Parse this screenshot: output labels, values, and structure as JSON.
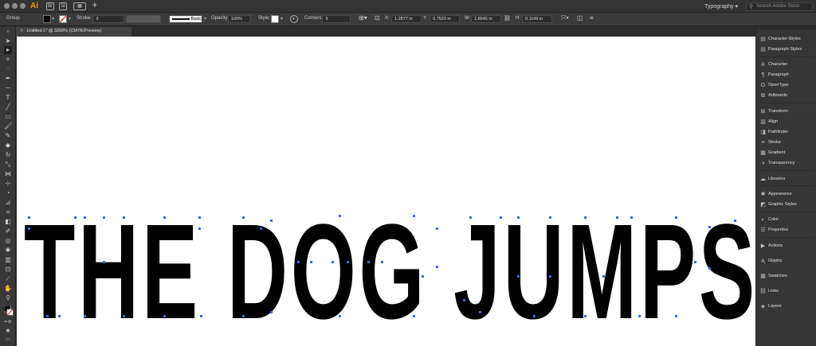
{
  "app": {
    "logo": "Ai",
    "workspace": "Typography",
    "search_placeholder": "Search Adobe Stock"
  },
  "titlebar_icons": [
    "Br",
    "St"
  ],
  "control": {
    "selection": "Group",
    "stroke_label": "Stroke:",
    "style_preset": "Basic",
    "opacity_label": "Opacity:",
    "opacity_value": "100%",
    "style_label": "Style:",
    "corners_label": "Corners:",
    "x_label": "X:",
    "x_value": "1.2877 in",
    "y_label": "Y:",
    "y_value": "0.7523 in",
    "w_label": "W:",
    "w_value": "1.8645 in",
    "h_label": "H:",
    "h_value": "0.1149 in"
  },
  "document": {
    "tab_title": "Untitled-1* @ 3200% (CMYK/Preview)"
  },
  "canvas": {
    "text": "THE DOG JUMPS"
  },
  "panels": [
    {
      "label": "Character Styles",
      "icon": "character-styles-icon"
    },
    {
      "label": "Paragraph Styles",
      "icon": "paragraph-styles-icon"
    },
    {
      "label": "Character",
      "icon": "character-icon"
    },
    {
      "label": "Paragraph",
      "icon": "paragraph-icon"
    },
    {
      "label": "OpenType",
      "icon": "opentype-icon"
    },
    {
      "label": "Artboards",
      "icon": "artboards-icon"
    },
    {
      "label": "Transform",
      "icon": "transform-icon"
    },
    {
      "label": "Align",
      "icon": "align-icon"
    },
    {
      "label": "Pathfinder",
      "icon": "pathfinder-icon"
    },
    {
      "label": "Stroke",
      "icon": "stroke-icon"
    },
    {
      "label": "Gradient",
      "icon": "gradient-icon"
    },
    {
      "label": "Transparency",
      "icon": "transparency-icon"
    },
    {
      "label": "Libraries",
      "icon": "libraries-icon"
    },
    {
      "label": "Appearance",
      "icon": "appearance-icon"
    },
    {
      "label": "Graphic Styles",
      "icon": "graphic-styles-icon"
    },
    {
      "label": "Color",
      "icon": "color-icon"
    },
    {
      "label": "Properties",
      "icon": "properties-icon"
    },
    {
      "label": "Actions",
      "icon": "actions-icon"
    },
    {
      "label": "Glyphs",
      "icon": "glyphs-icon"
    },
    {
      "label": "Swatches",
      "icon": "swatches-icon"
    },
    {
      "label": "Links",
      "icon": "links-icon"
    },
    {
      "label": "Layers",
      "icon": "layers-icon"
    }
  ],
  "colors": {
    "accent": "#ff9a00",
    "anchor": "#3d6bd6",
    "canvas": "#ffffff",
    "ui_dark": "#383838"
  }
}
